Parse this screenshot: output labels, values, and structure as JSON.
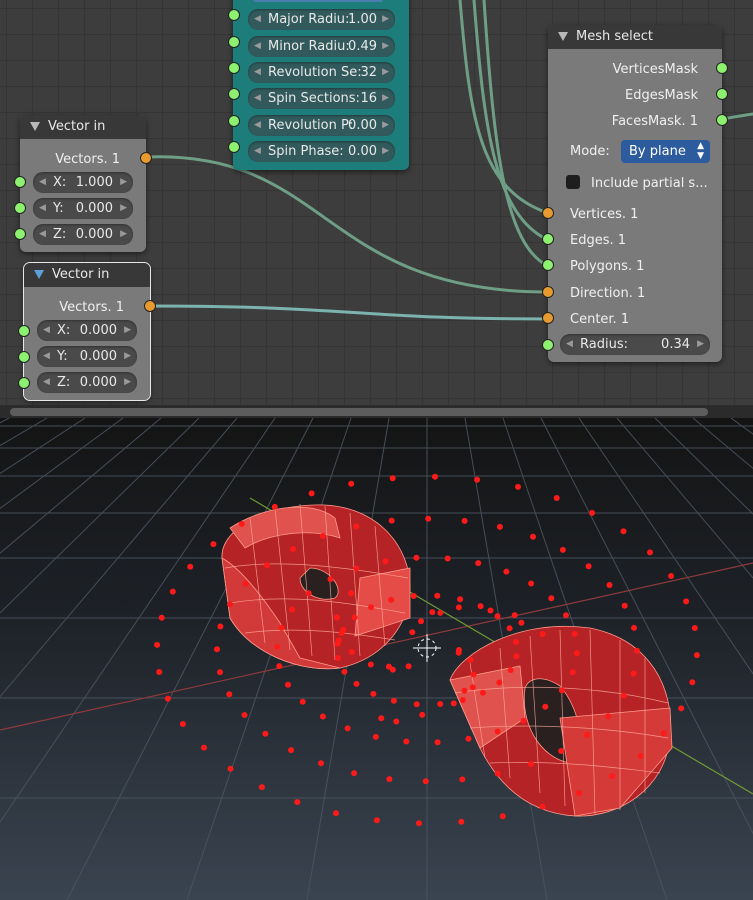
{
  "torus_node": {
    "fields": [
      {
        "label": "Major Radiu:",
        "value": "1.00"
      },
      {
        "label": "Minor Radiu:",
        "value": "0.49"
      },
      {
        "label": "Revolution Se:",
        "value": "32"
      },
      {
        "label": "Spin Sections:",
        "value": "16"
      },
      {
        "label": "Revolution P:",
        "value": "0.00"
      },
      {
        "label": "Spin Phase:",
        "value": "0.00"
      }
    ]
  },
  "vector_in_1": {
    "title": "Vector in",
    "output": "Vectors. 1",
    "fields": [
      {
        "label": "X:",
        "value": "1.000"
      },
      {
        "label": "Y:",
        "value": "0.000"
      },
      {
        "label": "Z:",
        "value": "0.000"
      }
    ]
  },
  "vector_in_2": {
    "title": "Vector in",
    "output": "Vectors. 1",
    "fields": [
      {
        "label": "X:",
        "value": "0.000"
      },
      {
        "label": "Y:",
        "value": "0.000"
      },
      {
        "label": "Z:",
        "value": "0.000"
      }
    ]
  },
  "mesh_select": {
    "title": "Mesh select",
    "outputs": [
      "VerticesMask",
      "EdgesMask",
      "FacesMask. 1"
    ],
    "mode_label": "Mode:",
    "mode_value": "By plane",
    "include_partial": "Include partial s...",
    "inputs": [
      "Vertices. 1",
      "Edges. 1",
      "Polygons. 1",
      "Direction. 1",
      "Center. 1"
    ],
    "radius_label": "Radius:",
    "radius_value": "0.34"
  },
  "colors": {
    "node_body": "#7a7a7a",
    "node_header": "#383838",
    "torus_node": "#1c7d7b",
    "wire": "#6f9e86",
    "vertex_dot": "#ff1a1a",
    "mesh_face": "#c8282a",
    "dropdown": "#2c5b9e"
  }
}
